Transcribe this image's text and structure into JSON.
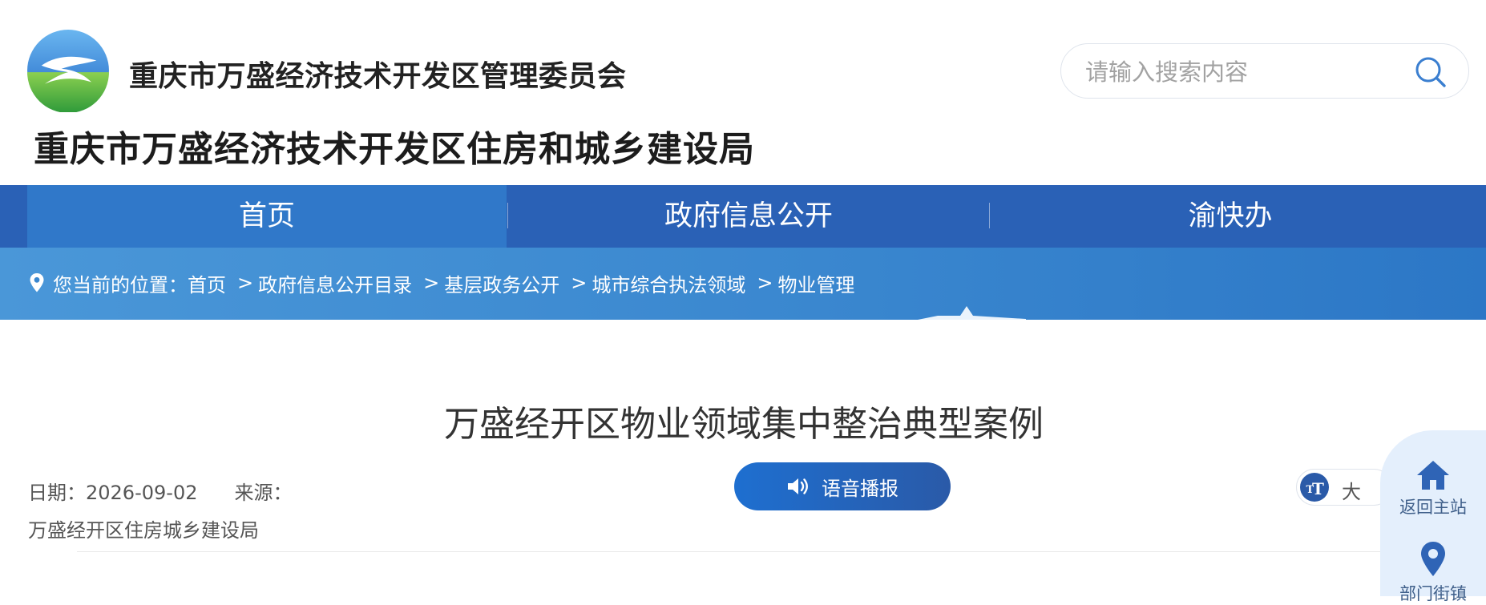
{
  "header": {
    "org_name": "重庆市万盛经济技术开发区管理委员会",
    "dept_name": "重庆市万盛经济技术开发区住房和城乡建设局",
    "search_placeholder": "请输入搜索内容"
  },
  "nav": {
    "items": [
      {
        "label": "首页",
        "active": true
      },
      {
        "label": "政府信息公开",
        "active": false
      },
      {
        "label": "渝快办",
        "active": false
      }
    ]
  },
  "breadcrumb": {
    "prefix": "您当前的位置：",
    "items": [
      "首页",
      "政府信息公开目录",
      "基层政务公开",
      "城市综合执法领域",
      "物业管理"
    ],
    "separator": ">"
  },
  "article": {
    "title": "万盛经开区物业领域集中整治典型案例",
    "date_label": "日期：",
    "date": "2026-09-02",
    "source_label": "来源：",
    "source": "万盛经开区住房城乡建设局"
  },
  "tools": {
    "voice_label": "语音播报",
    "fontsize_label": "大"
  },
  "float_panel": {
    "items": [
      {
        "label": "返回主站",
        "icon": "home-icon"
      },
      {
        "label": "部门街镇",
        "icon": "location-icon"
      }
    ]
  },
  "colors": {
    "nav_bg": "#2a61b6",
    "nav_active": "#3078c9",
    "banner": "#3a87cf",
    "voice_button": "#1e6fd0",
    "float_panel_bg": "#e4effc"
  }
}
